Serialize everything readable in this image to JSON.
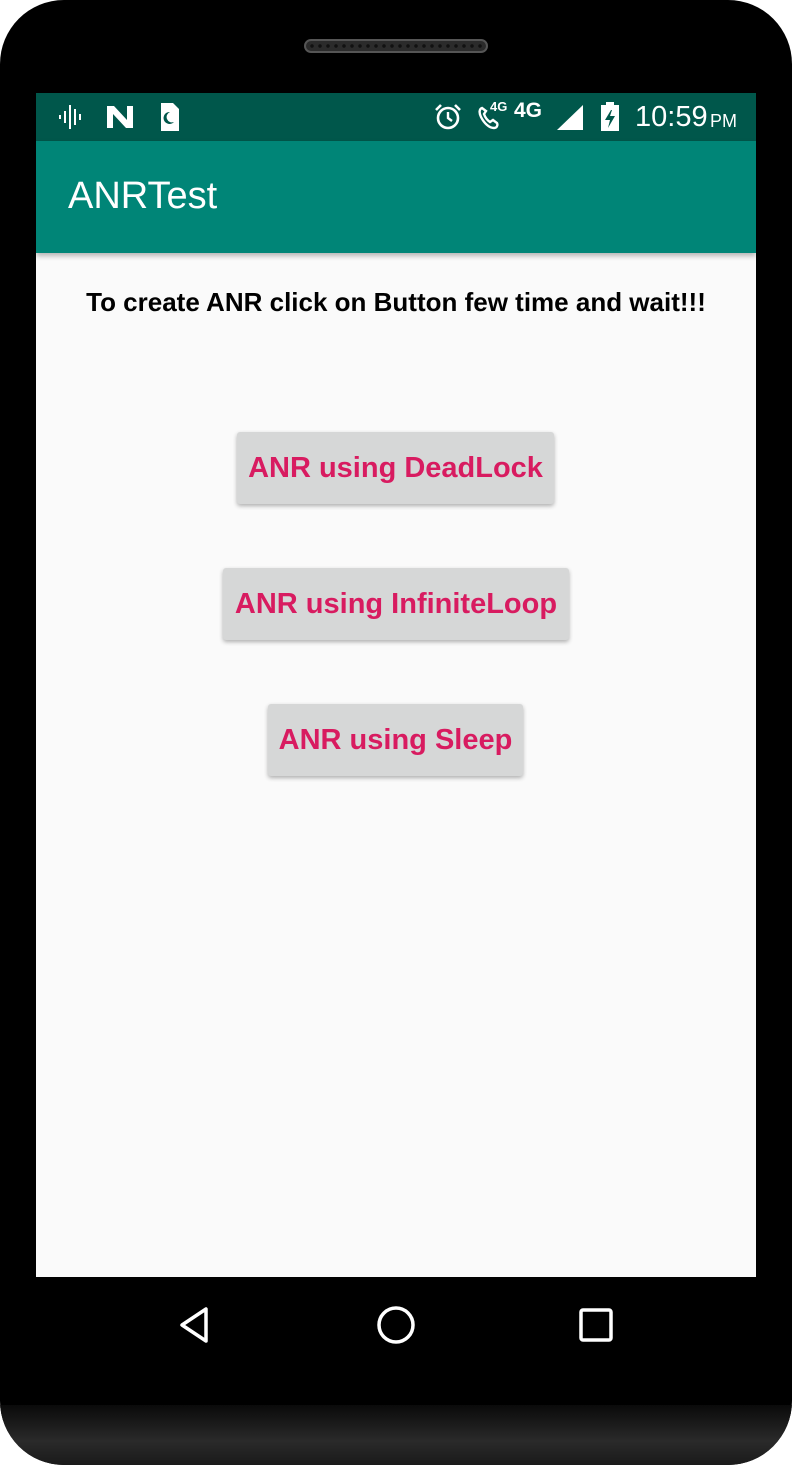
{
  "status_bar": {
    "time": "10:59",
    "ampm": "PM",
    "network_type": "4G",
    "call_label": "4G",
    "icons": [
      "voicemail-icon",
      "n-notification-icon",
      "sim-icon",
      "alarm-icon",
      "volte-call-icon",
      "signal-icon",
      "battery-charging-icon"
    ]
  },
  "app_bar": {
    "title": "ANRTest"
  },
  "main": {
    "instruction": "To create ANR click on Button few time and wait!!!",
    "buttons": [
      {
        "label": "ANR using DeadLock"
      },
      {
        "label": "ANR using InfiniteLoop"
      },
      {
        "label": "ANR using Sleep"
      }
    ]
  },
  "nav_bar": {
    "icons": [
      "back-icon",
      "home-icon",
      "recents-icon"
    ]
  },
  "colors": {
    "status_bar": "#00574b",
    "app_bar": "#008577",
    "accent": "#d81b60",
    "button_bg": "#d6d7d7",
    "background": "#fafafa"
  }
}
